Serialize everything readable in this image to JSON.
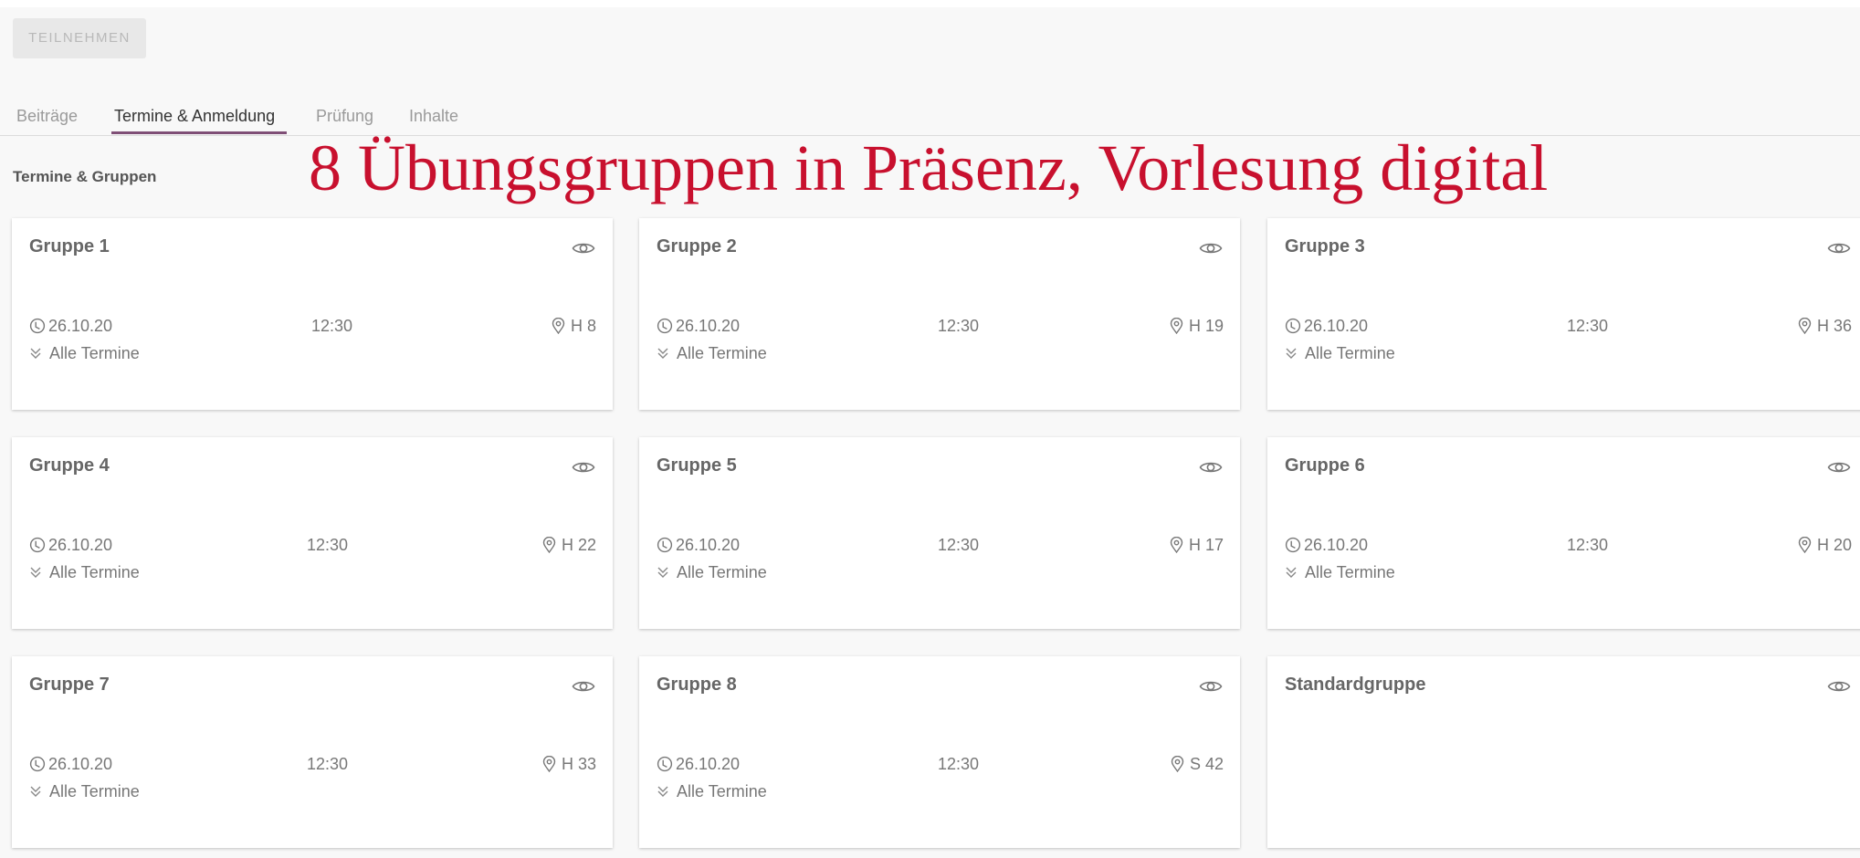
{
  "toolbar": {
    "join_label": "TEILNEHMEN"
  },
  "tabs": [
    {
      "label": "Beiträge"
    },
    {
      "label": "Termine & Anmeldung"
    },
    {
      "label": "Prüfung"
    },
    {
      "label": "Inhalte"
    }
  ],
  "active_tab": "Termine & Anmeldung",
  "section": {
    "title": "Termine & Gruppen"
  },
  "overlay_caption": "8 Übungsgruppen in Präsenz, Vorlesung digital",
  "overlay_color": "#c8102e",
  "accent_color": "#7f4f76",
  "groups": [
    {
      "name": "Gruppe 1",
      "date": "26.10.20",
      "time": "12:30",
      "room": "H 8",
      "all_dates": "Alle Termine"
    },
    {
      "name": "Gruppe 2",
      "date": "26.10.20",
      "time": "12:30",
      "room": "H 19",
      "all_dates": "Alle Termine"
    },
    {
      "name": "Gruppe 3",
      "date": "26.10.20",
      "time": "12:30",
      "room": "H 36",
      "all_dates": "Alle Termine"
    },
    {
      "name": "Gruppe 4",
      "date": "26.10.20",
      "time": "12:30",
      "room": "H 22",
      "all_dates": "Alle Termine"
    },
    {
      "name": "Gruppe 5",
      "date": "26.10.20",
      "time": "12:30",
      "room": "H 17",
      "all_dates": "Alle Termine"
    },
    {
      "name": "Gruppe 6",
      "date": "26.10.20",
      "time": "12:30",
      "room": "H 20",
      "all_dates": "Alle Termine"
    },
    {
      "name": "Gruppe 7",
      "date": "26.10.20",
      "time": "12:30",
      "room": "H 33",
      "all_dates": "Alle Termine"
    },
    {
      "name": "Gruppe 8",
      "date": "26.10.20",
      "time": "12:30",
      "room": "S 42",
      "all_dates": "Alle Termine"
    },
    {
      "name": "Standardgruppe"
    }
  ],
  "icons": {
    "view": "eye-icon",
    "time": "clock-icon",
    "location": "location-pin-icon",
    "expand": "double-chevron-down-icon"
  }
}
